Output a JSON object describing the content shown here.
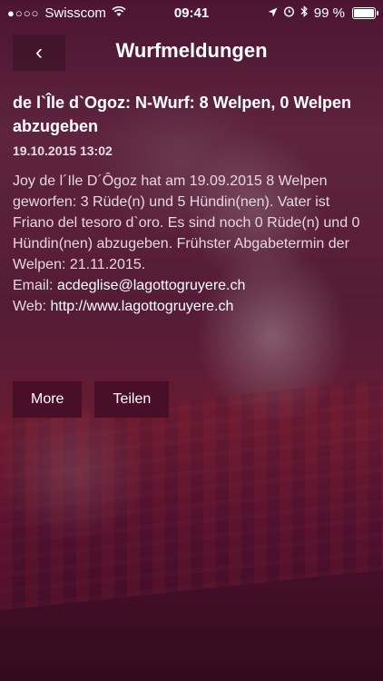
{
  "status_bar": {
    "carrier_dots": "●○○○",
    "carrier": "Swisscom",
    "time": "09:41",
    "battery_text": "99 %",
    "battery_level": 0.99
  },
  "nav": {
    "back_icon": "‹",
    "title": "Wurfmeldungen"
  },
  "article": {
    "headline": "de l`Île d`Ogoz: N-Wurf: 8 Welpen, 0 Welpen abzugeben",
    "date": "19.10.2015 13:02",
    "body": "Joy de l´Ile D´Ôgoz hat am 19.09.2015 8 Welpen geworfen: 3 Rüde(n) und 5 Hündin(nen). Vater ist Friano del tesoro d`oro. Es sind noch 0 Rüde(n) und 0 Hündin(nen) abzugeben. Frühster Abgabetermin der Welpen: 21.11.2015.",
    "email_label": "Email:",
    "email": "acdeglise@lagottogruyere.ch",
    "web_label": "Web:",
    "web": "http://www.lagottogruyere.ch"
  },
  "buttons": {
    "more": "More",
    "share": "Teilen"
  }
}
